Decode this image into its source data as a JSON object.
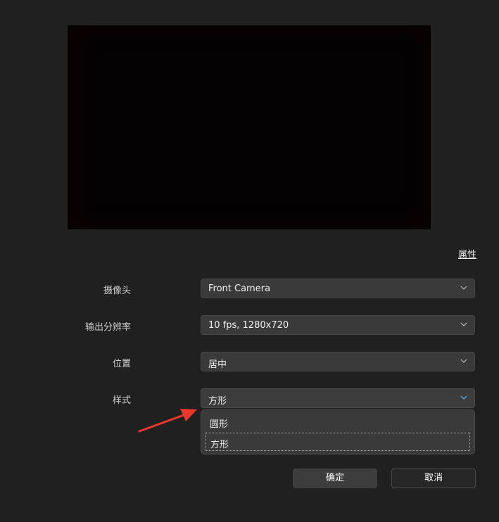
{
  "properties_link": "属性",
  "fields": [
    {
      "label": "摄像头",
      "value": "Front Camera"
    },
    {
      "label": "输出分辨率",
      "value": "10 fps, 1280x720"
    },
    {
      "label": "位置",
      "value": "居中"
    },
    {
      "label": "样式",
      "value": "方形"
    }
  ],
  "style_dropdown": {
    "options": [
      "圆形",
      "方形"
    ],
    "selected": "方形"
  },
  "buttons": {
    "ok": "确定",
    "cancel": "取消"
  },
  "colors": {
    "background": "#202020",
    "field": "#3a3a3a",
    "active_chevron": "#4fa3e0",
    "annotation_arrow": "#e8372b"
  },
  "icons": {
    "dropdown": "chevron-down-icon",
    "annotation": "red-arrow"
  }
}
